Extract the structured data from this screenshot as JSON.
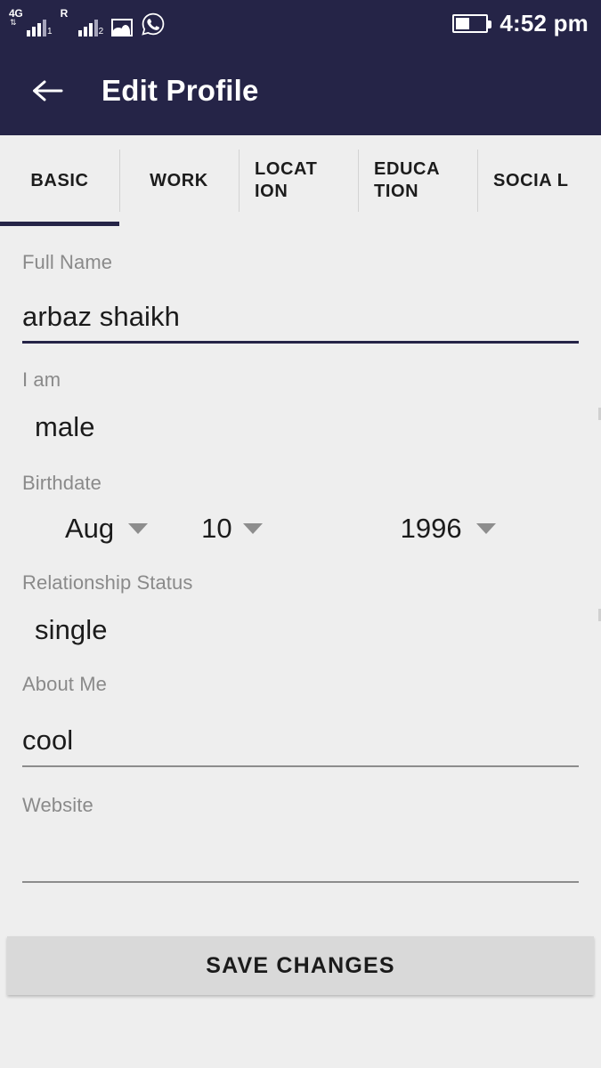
{
  "statusbar": {
    "sim1": {
      "network_badge": "4G",
      "data_arrows": "⇅",
      "sim_index": "1"
    },
    "sim2": {
      "network_badge": "R",
      "sim_index": "2"
    },
    "gallery_icon": "gallery-icon",
    "whatsapp_icon": "whatsapp-icon",
    "battery_icon": "battery-icon",
    "time": "4:52 pm"
  },
  "appbar": {
    "back_icon": "back-arrow-icon",
    "title": "Edit Profile",
    "background": "#252447"
  },
  "tabs": [
    {
      "label": "BASIC",
      "active": true
    },
    {
      "label": "WORK",
      "active": false
    },
    {
      "label": "LOCAT\nION",
      "active": false
    },
    {
      "label": "EDUCA\nTION",
      "active": false
    },
    {
      "label": "SOCIA\nL",
      "active": false
    }
  ],
  "form": {
    "full_name": {
      "label": "Full Name",
      "value": "arbaz shaikh",
      "focused": true
    },
    "i_am": {
      "label": "I am",
      "value": "male"
    },
    "birthdate": {
      "label": "Birthdate",
      "month": "Aug",
      "day": "10",
      "year": "1996",
      "caret_icon": "chevron-down-icon"
    },
    "relationship_status": {
      "label": "Relationship Status",
      "value": "single"
    },
    "about_me": {
      "label": "About Me",
      "value": "cool"
    },
    "website": {
      "label": "Website",
      "value": "",
      "placeholder": ""
    }
  },
  "save_button": {
    "label": "SAVE CHANGES"
  },
  "colors": {
    "accent": "#252447",
    "page_background": "#eeeeee",
    "label_gray": "#8a8a8a",
    "button_gray": "#d9d9d9"
  }
}
